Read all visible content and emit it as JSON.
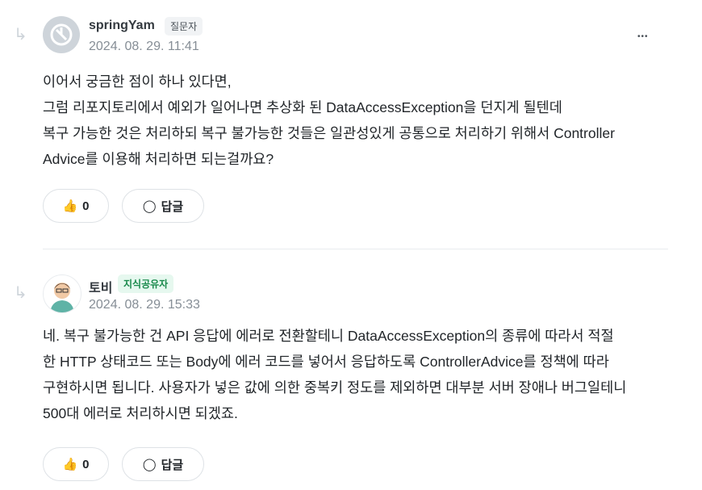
{
  "comments": [
    {
      "author": "springYam",
      "role": "질문자",
      "date": "2024. 08. 29. 11:41",
      "lines": [
        "이어서 궁금한 점이 하나 있다면,",
        "그럼 리포지토리에서 예외가 일어나면 추상화 된 DataAccessException을 던지게 될텐데",
        "복구 가능한 것은 처리하되 복구 불가능한 것들은 일관성있게 공통으로 처리하기 위해서 Controller",
        "Advice를 이용해 처리하면 되는걸까요?"
      ],
      "likes": "0",
      "reply": "답글",
      "more": "•••"
    },
    {
      "author": "토비",
      "role": "지식공유자",
      "date": "2024. 08. 29. 15:33",
      "lines": [
        "네. 복구 불가능한 건 API 응답에 에러로 전환할테니 DataAccessException의 종류에 따라서 적절",
        "한 HTTP 상태코드 또는 Body에 에러 코드를 넣어서 응답하도록 ControllerAdvice를 정책에 따라",
        "구현하시면 됩니다. 사용자가 넣은 값에 의한 중복키 정도를 제외하면 대부분 서버 장애나 버그일테니",
        "500대 에러로 처리하시면 되겠죠."
      ],
      "likes": "0",
      "reply": "답글"
    }
  ]
}
